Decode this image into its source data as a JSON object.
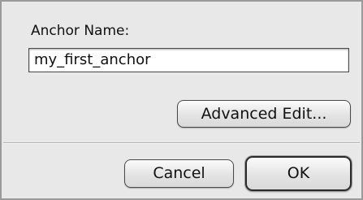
{
  "dialog": {
    "field_label": "Anchor Name:",
    "field_value": "my_first_anchor",
    "advanced_edit_label": "Advanced Edit...",
    "cancel_label": "Cancel",
    "ok_label": "OK"
  }
}
